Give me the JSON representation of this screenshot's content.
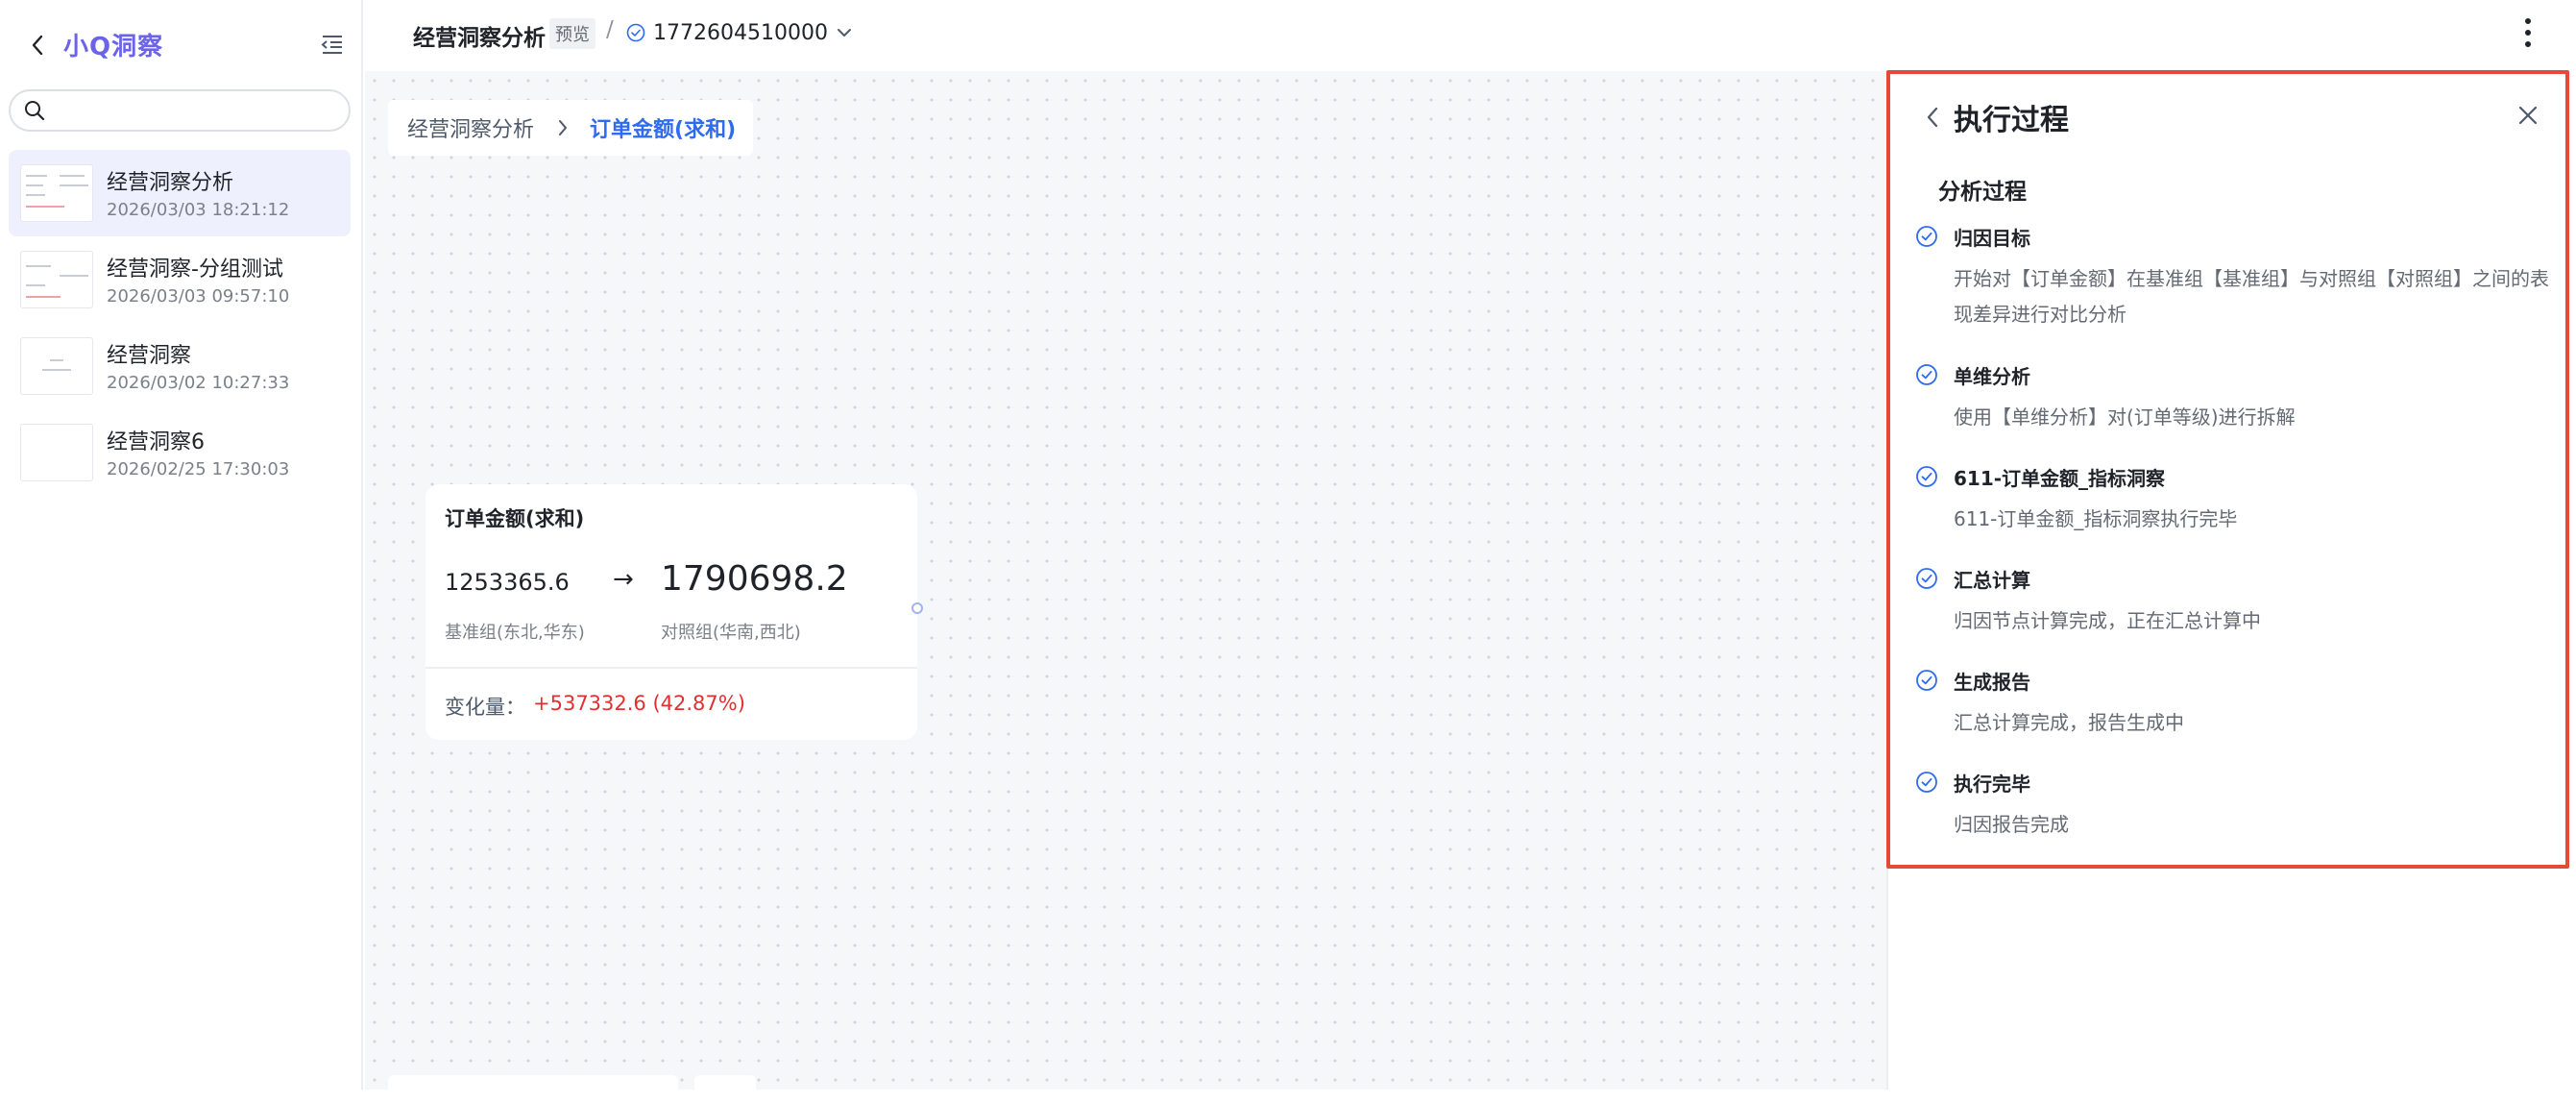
{
  "sidebar": {
    "logo": "小Q洞察",
    "search": {
      "placeholder": "",
      "value": ""
    },
    "items": [
      {
        "title": "经营洞察分析",
        "date": "2026/03/03 18:21:12",
        "active": true
      },
      {
        "title": "经营洞察-分组测试",
        "date": "2026/03/03 09:57:10",
        "active": false
      },
      {
        "title": "经营洞察",
        "date": "2026/03/02 10:27:33",
        "active": false
      },
      {
        "title": "经营洞察6",
        "date": "2026/02/25 17:30:03",
        "active": false
      }
    ]
  },
  "topbar": {
    "title": "经营洞察分析",
    "badge": "预览",
    "separator": "/",
    "version": "1772604510000"
  },
  "canvas": {
    "breadcrumb": {
      "parent": "经营洞察分析",
      "current": "订单金额(求和)"
    },
    "metric_card": {
      "title": "订单金额(求和)",
      "base_value": "1253365.6",
      "arrow": "→",
      "compare_value": "1790698.2",
      "base_label": "基准组(东北,华东)",
      "compare_label": "对照组(华南,西北)",
      "change_label": "变化量：",
      "change_value": "+537332.6 (42.87%)"
    }
  },
  "panel": {
    "title": "执行过程",
    "section": "分析过程",
    "steps": [
      {
        "name": "归因目标",
        "desc": "开始对【订单金额】在基准组【基准组】与对照组【对照组】之间的表现差异进行对比分析"
      },
      {
        "name": "单维分析",
        "desc": "使用【单维分析】对(订单等级)进行拆解"
      },
      {
        "name": "611-订单金额_指标洞察",
        "desc": "611-订单金额_指标洞察执行完毕"
      },
      {
        "name": "汇总计算",
        "desc": "归因节点计算完成，正在汇总计算中"
      },
      {
        "name": "生成报告",
        "desc": "汇总计算完成，报告生成中"
      },
      {
        "name": "执行完毕",
        "desc": "归因报告完成"
      }
    ]
  },
  "colors": {
    "accent": "#2f6bef",
    "logo": "#6b64e8",
    "negative_change": "#e03131",
    "highlight_frame": "#e6493a",
    "active_item_bg": "#eef1fd"
  },
  "icons": [
    "chevron-left-icon",
    "collapse-menu-icon",
    "search-icon",
    "check-circle-icon",
    "chevron-down-icon",
    "more-vertical-icon",
    "chevron-right-icon",
    "close-icon"
  ]
}
